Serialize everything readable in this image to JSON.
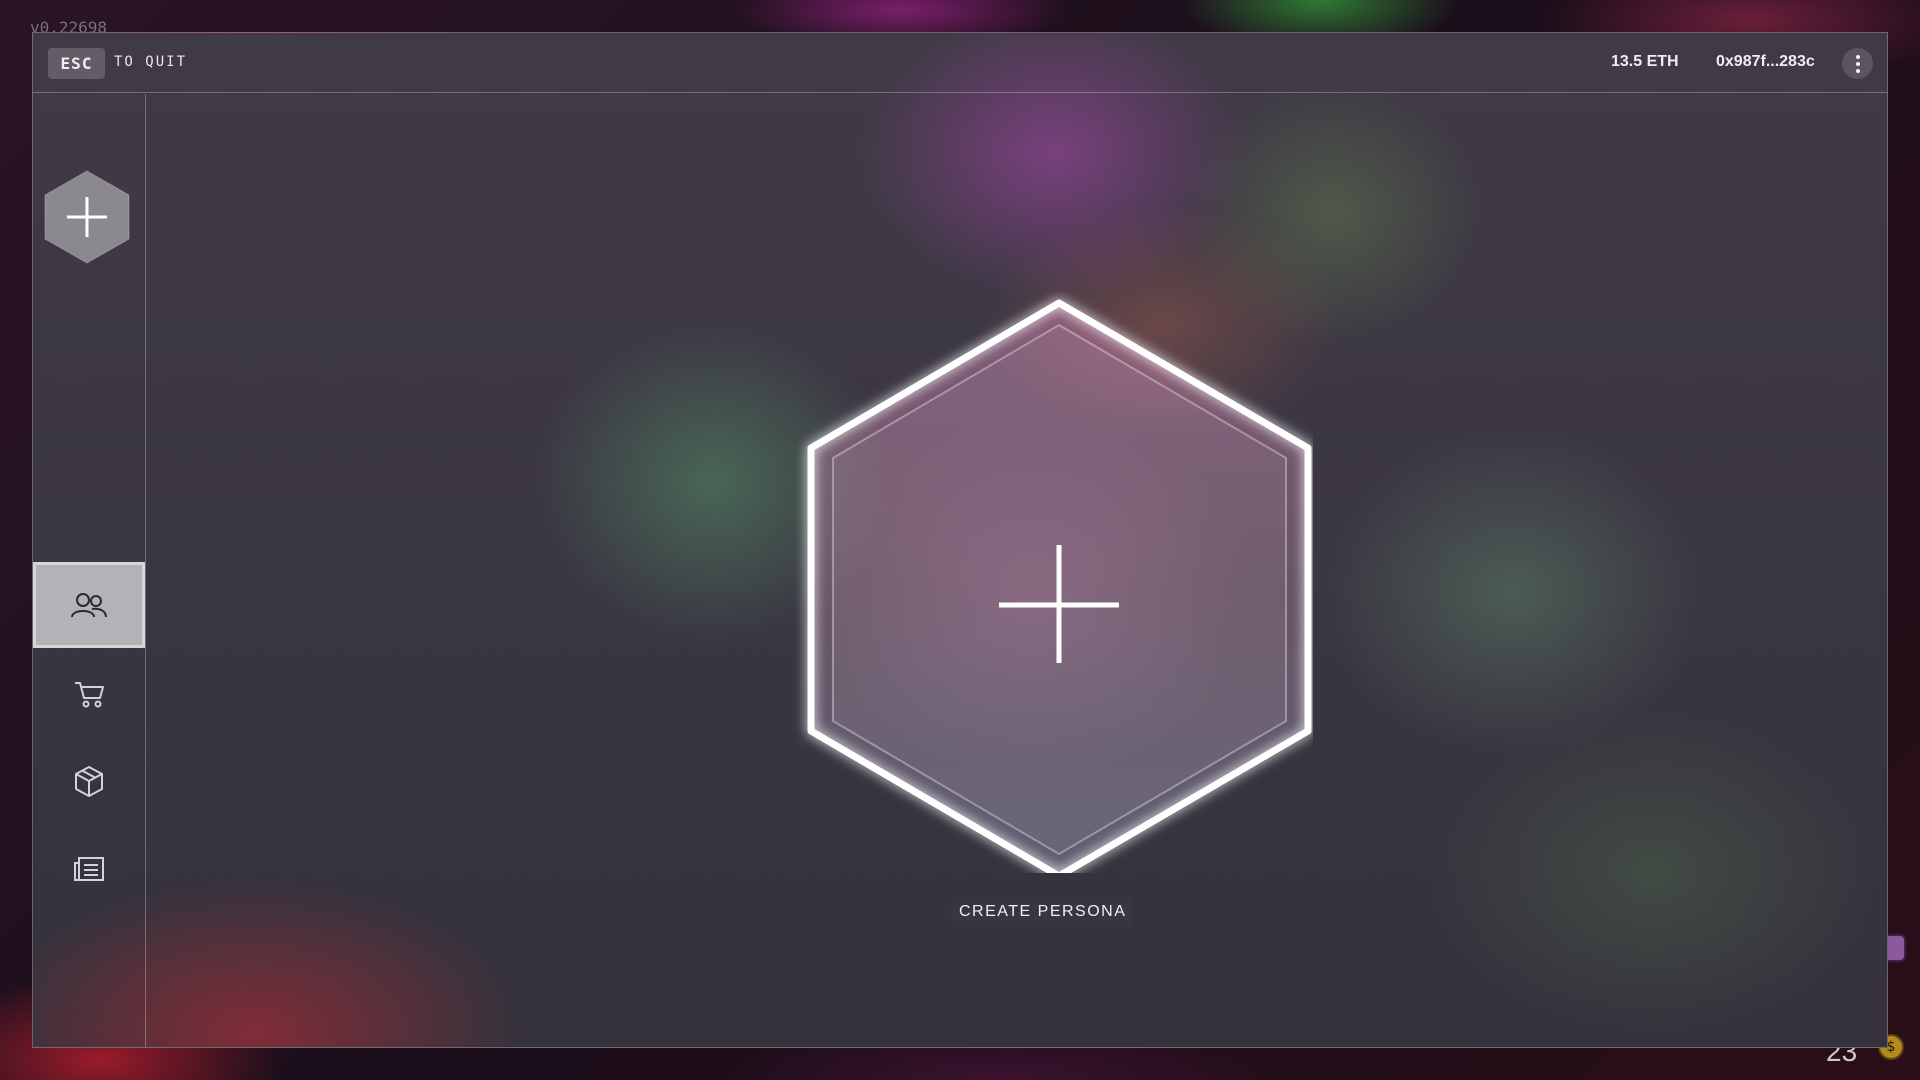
{
  "game": {
    "version": "v0.22698",
    "corner_number": "23"
  },
  "topbar": {
    "esc_key": "ESC",
    "quit_label": "TO QUIT",
    "balance": "13.5 ETH",
    "wallet_address": "0x987f...283c",
    "menu_icon": "kebab-menu-icon"
  },
  "sidebar": {
    "add_button_icon": "plus-icon",
    "items": [
      {
        "name": "personas",
        "icon": "users-icon",
        "active": true
      },
      {
        "name": "shop",
        "icon": "cart-icon",
        "active": false
      },
      {
        "name": "inventory",
        "icon": "box-icon",
        "active": false
      },
      {
        "name": "news",
        "icon": "list-icon",
        "active": false
      }
    ]
  },
  "main": {
    "create_icon": "plus-icon",
    "create_label": "CREATE PERSONA"
  },
  "colors": {
    "panel": "#3c3844",
    "glow": "#ffffff",
    "accent_magenta": "#a846aa",
    "accent_green": "#5aa06e"
  }
}
